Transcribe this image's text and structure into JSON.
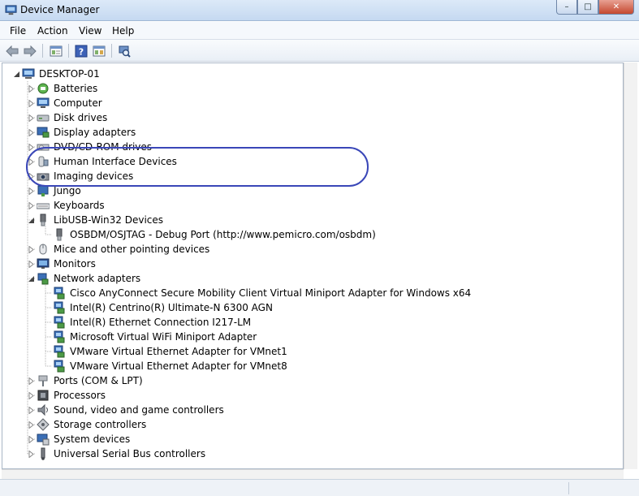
{
  "window": {
    "title": "Device Manager",
    "controls": {
      "minimize": "–",
      "maximize": "□",
      "close": "✕"
    }
  },
  "menu": [
    "File",
    "Action",
    "View",
    "Help"
  ],
  "toolbar": [
    "back-arrow-icon",
    "forward-arrow-icon",
    "properties-icon",
    "help-icon",
    "show-hidden-icon",
    "scan-hardware-icon"
  ],
  "tree": {
    "root": "DESKTOP-01",
    "categories": [
      {
        "label": "Batteries",
        "icon": "battery-icon",
        "expanded": false
      },
      {
        "label": "Computer",
        "icon": "computer-icon",
        "expanded": false
      },
      {
        "label": "Disk drives",
        "icon": "disk-drive-icon",
        "expanded": false
      },
      {
        "label": "Display adapters",
        "icon": "display-adapter-icon",
        "expanded": false
      },
      {
        "label": "DVD/CD-ROM drives",
        "icon": "dvd-drive-icon",
        "expanded": false
      },
      {
        "label": "Human Interface Devices",
        "icon": "hid-icon",
        "expanded": false
      },
      {
        "label": "Imaging devices",
        "icon": "camera-icon",
        "expanded": false
      },
      {
        "label": "Jungo",
        "icon": "jungo-icon",
        "expanded": false
      },
      {
        "label": "Keyboards",
        "icon": "keyboard-icon",
        "expanded": false
      },
      {
        "label": "LibUSB-Win32 Devices",
        "icon": "usb-plug-icon",
        "expanded": true,
        "children": [
          "OSBDM/OSJTAG - Debug Port (http://www.pemicro.com/osbdm)"
        ]
      },
      {
        "label": "Mice and other pointing devices",
        "icon": "mouse-icon",
        "expanded": false
      },
      {
        "label": "Monitors",
        "icon": "monitor-icon",
        "expanded": false
      },
      {
        "label": "Network adapters",
        "icon": "network-adapter-icon",
        "expanded": true,
        "children": [
          "Cisco AnyConnect Secure Mobility Client Virtual Miniport Adapter for Windows x64",
          "Intel(R) Centrino(R) Ultimate-N 6300 AGN",
          "Intel(R) Ethernet Connection I217-LM",
          "Microsoft Virtual WiFi Miniport Adapter",
          "VMware Virtual Ethernet Adapter for VMnet1",
          "VMware Virtual Ethernet Adapter for VMnet8"
        ]
      },
      {
        "label": "Ports (COM & LPT)",
        "icon": "port-icon",
        "expanded": false
      },
      {
        "label": "Processors",
        "icon": "processor-icon",
        "expanded": false
      },
      {
        "label": "Sound, video and game controllers",
        "icon": "sound-icon",
        "expanded": false
      },
      {
        "label": "Storage controllers",
        "icon": "storage-controller-icon",
        "expanded": false
      },
      {
        "label": "System devices",
        "icon": "system-devices-icon",
        "expanded": false
      },
      {
        "label": "Universal Serial Bus controllers",
        "icon": "usb-controller-icon",
        "expanded": false
      }
    ]
  },
  "colors": {
    "annotation": "#3a47b8",
    "titlebar": "#c5d9f1"
  }
}
